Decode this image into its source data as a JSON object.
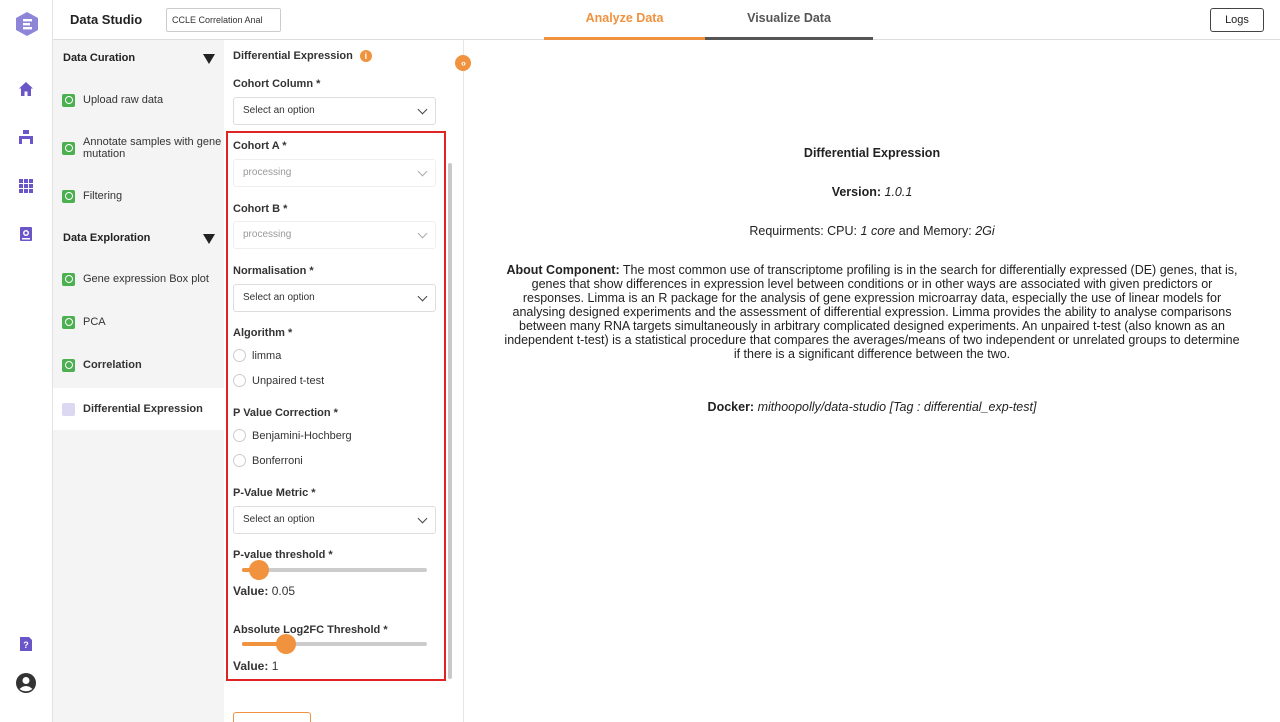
{
  "app": {
    "title": "Data Studio",
    "project_name": "CCLE Correlation Anal"
  },
  "rail": {
    "icons": [
      "logo-icon",
      "home-icon",
      "workflow-icon",
      "apps-grid-icon",
      "id-badge-icon",
      "help-icon",
      "user-account-icon"
    ]
  },
  "tabs": [
    {
      "label": "Analyze Data",
      "active": true
    },
    {
      "label": "Visualize Data",
      "active": false
    }
  ],
  "header": {
    "logs_label": "Logs"
  },
  "sidebar": {
    "sections": [
      {
        "title": "Data Curation",
        "steps": [
          {
            "label": "Upload raw data",
            "status": "done"
          },
          {
            "label": "Annotate samples with gene mutation",
            "status": "done"
          },
          {
            "label": "Filtering",
            "status": "done"
          }
        ]
      },
      {
        "title": "Data Exploration",
        "steps": [
          {
            "label": "Gene expression Box plot",
            "status": "done"
          },
          {
            "label": "PCA",
            "status": "done"
          },
          {
            "label": "Correlation",
            "status": "done"
          },
          {
            "label": "Differential Expression",
            "status": "active"
          }
        ]
      }
    ]
  },
  "form": {
    "title": "Differential Expression",
    "info_icon": "info-icon",
    "cohort_column": {
      "label": "Cohort Column *",
      "value": "Select an option"
    },
    "cohort_a": {
      "label": "Cohort A *",
      "value": "processing"
    },
    "cohort_b": {
      "label": "Cohort B *",
      "value": "processing"
    },
    "normalisation": {
      "label": "Normalisation *",
      "value": "Select an option"
    },
    "algorithm": {
      "label": "Algorithm *",
      "options": [
        "limma",
        "Unpaired t-test"
      ]
    },
    "p_value_correction": {
      "label": "P Value Correction *",
      "options": [
        "Benjamini-Hochberg",
        "Bonferroni"
      ]
    },
    "p_value_metric": {
      "label": "P-Value Metric *",
      "value": "Select an option"
    },
    "p_value_threshold": {
      "label": "P-value threshold *",
      "value_label": "Value:",
      "value": "0.05",
      "fraction": 0.09
    },
    "log2fc_threshold": {
      "label": "Absolute Log2FC Threshold *",
      "value_label": "Value:",
      "value": "1",
      "fraction": 0.24
    },
    "accent_color": "#f0923e"
  },
  "component": {
    "title": "Differential Expression",
    "version_label": "Version:",
    "version": "1.0.1",
    "req_prefix": "Requirments: CPU:",
    "cpu": "1 core",
    "req_mid": "and Memory:",
    "memory": "2Gi",
    "about_label": "About Component:",
    "about_text": "The most common use of transcriptome profiling is in the search for differentially expressed (DE) genes, that is, genes that show differences in expression level between conditions or in other ways are associated with given predictors or responses. Limma is an R package for the analysis of gene expression microarray data, especially the use of linear models for analysing designed experiments and the assessment of differential expression. Limma provides the ability to analyse comparisons between many RNA targets simultaneously in arbitrary complicated designed experiments. An unpaired t-test (also known as an independent t-test) is a statistical procedure that compares the averages/means of two independent or unrelated groups to determine if there is a significant difference between the two.",
    "docker_label": "Docker:",
    "docker_value": "mithoopolly/data-studio [Tag : differential_exp-test]"
  }
}
